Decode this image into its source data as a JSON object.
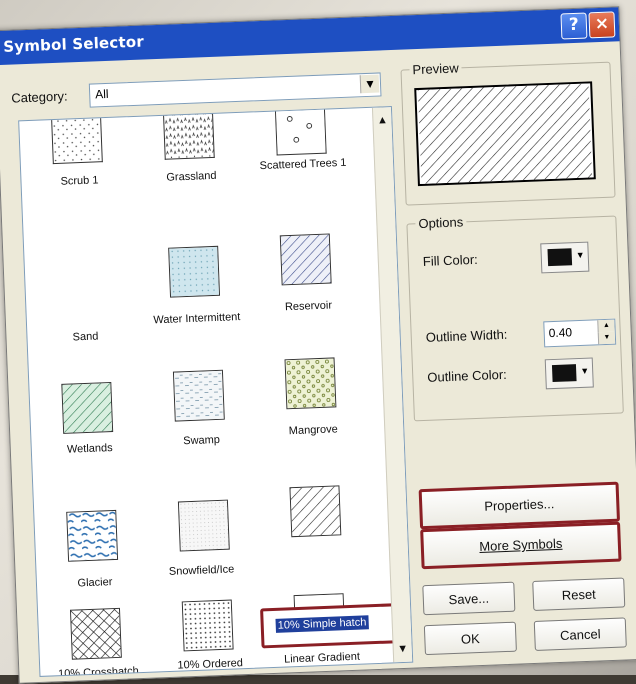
{
  "window": {
    "title": "Symbol Selector",
    "help_label": "?",
    "close_label": "×"
  },
  "category": {
    "label": "Category:",
    "value": "All"
  },
  "gallery": {
    "symbols": [
      {
        "label": "Scrub 1",
        "icon": "scrub-dots"
      },
      {
        "label": "Grassland",
        "icon": "grassland-pattern"
      },
      {
        "label": "Scattered Trees 1",
        "icon": "scattered-trees-pattern"
      },
      {
        "label": "Sand",
        "icon": "sand-dots"
      },
      {
        "label": "Water Intermittent",
        "icon": "water-intermittent-pattern"
      },
      {
        "label": "Reservoir",
        "icon": "reservoir-hatch"
      },
      {
        "label": "Wetlands",
        "icon": "wetlands-hatch"
      },
      {
        "label": "Swamp",
        "icon": "swamp-pattern"
      },
      {
        "label": "Mangrove",
        "icon": "mangrove-pattern"
      },
      {
        "label": "Glacier",
        "icon": "glacier-pattern"
      },
      {
        "label": "Snowfield/Ice",
        "icon": "snowfield-pattern"
      },
      {
        "label": "10% Simple hatch",
        "icon": "simple-hatch"
      },
      {
        "label": "10% Crosshatch",
        "icon": "crosshatch"
      },
      {
        "label": "10% Ordered",
        "icon": "ordered-dots"
      },
      {
        "label": "Linear Gradient",
        "icon": "linear-gradient"
      }
    ],
    "rename_value": "10% Simple hatch",
    "scroll_up_icon": "scroll-up-arrow",
    "scroll_down_icon": "scroll-down-arrow"
  },
  "preview": {
    "label": "Preview"
  },
  "options": {
    "label": "Options",
    "fill_color_label": "Fill Color:",
    "fill_color": "#111111",
    "outline_width_label": "Outline Width:",
    "outline_width_value": "0.40",
    "outline_color_label": "Outline Color:",
    "outline_color": "#111111"
  },
  "buttons": {
    "properties": "Properties...",
    "more_symbols": "More Symbols",
    "save": "Save...",
    "reset": "Reset",
    "ok": "OK",
    "cancel": "Cancel"
  },
  "colors": {
    "highlight": "#8a1f25",
    "title_bar": "#1e4fc2",
    "selection": "#1f3f9c"
  }
}
